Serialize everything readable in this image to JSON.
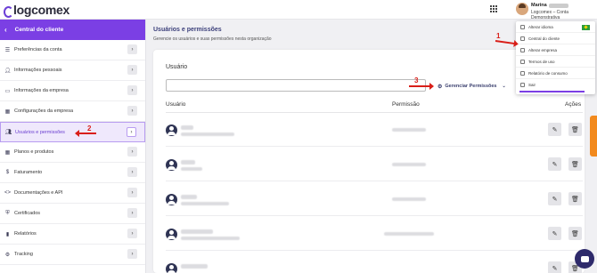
{
  "header": {
    "logo_text": "logcomex",
    "user_name": "Marina",
    "user_company": "Logcomex – Conta Demonstrativa"
  },
  "sidebar": {
    "title": "Central do cliente",
    "items": [
      {
        "label": "Preferências da conta",
        "icon": "sliders-icon"
      },
      {
        "label": "Informações pessoais",
        "icon": "person-icon"
      },
      {
        "label": "Informações da empresa",
        "icon": "briefcase-icon"
      },
      {
        "label": "Configurações da empresa",
        "icon": "building-icon"
      },
      {
        "label": "Usuários e permissões",
        "icon": "users-icon"
      },
      {
        "label": "Planos e produtos",
        "icon": "grid-icon"
      },
      {
        "label": "Faturamento",
        "icon": "dollar-icon"
      },
      {
        "label": "Documentações e API",
        "icon": "code-icon"
      },
      {
        "label": "Certificados",
        "icon": "shield-icon"
      },
      {
        "label": "Relatórios",
        "icon": "bar-chart-icon"
      },
      {
        "label": "Tracking",
        "icon": "gear-icon"
      }
    ]
  },
  "main": {
    "title": "Usuários e permissões",
    "subtitle": "Gerencie os usuários e suas permissões nesta organização",
    "field_label": "Usuário",
    "manage_button": "Gerenciar Permissões",
    "columns": {
      "user": "Usuário",
      "permission": "Permissão",
      "actions": "Ações"
    }
  },
  "user_menu": {
    "items": [
      {
        "label": "Alterar idioma"
      },
      {
        "label": "Central do cliente"
      },
      {
        "label": "Alterar empresa"
      },
      {
        "label": "Termos de uso"
      },
      {
        "label": "Relatório de consumo"
      },
      {
        "label": "Sair"
      }
    ]
  },
  "annotations": {
    "step1": "1",
    "step2": "2",
    "step3": "3"
  },
  "colors": {
    "accent": "#7b3fe4",
    "annotation": "#d91e18",
    "feedback": "#f28a1e"
  }
}
